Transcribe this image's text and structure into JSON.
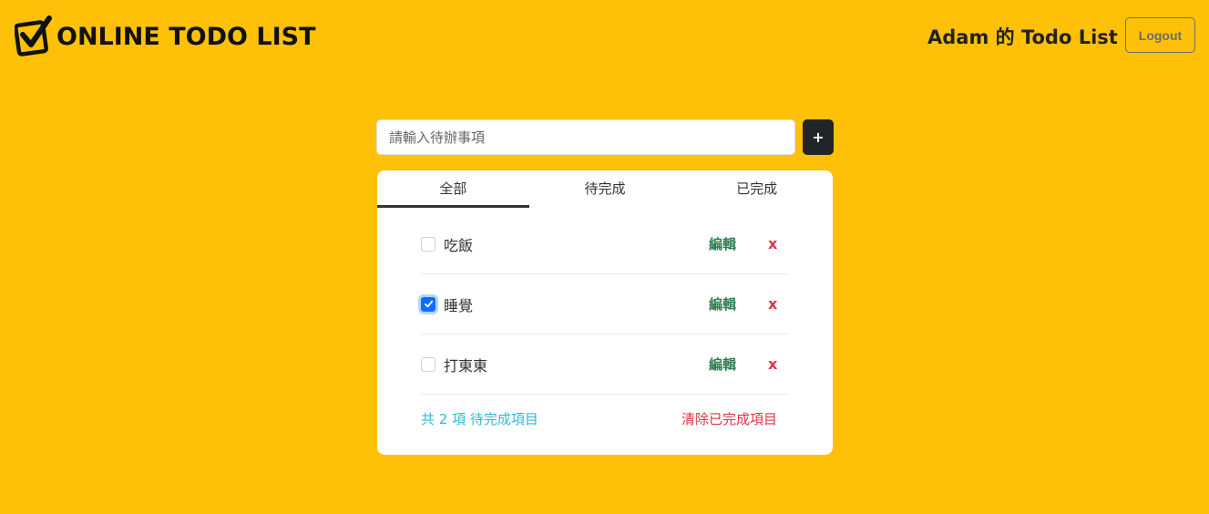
{
  "header": {
    "logo_text": "ONLINE TODO LIST",
    "user_title": "Adam 的 Todo List",
    "logout_label": "Logout"
  },
  "new_todo": {
    "placeholder": "請輸入待辦事項",
    "add_label": "+"
  },
  "tabs": [
    {
      "label": "全部",
      "active": true
    },
    {
      "label": "待完成",
      "active": false
    },
    {
      "label": "已完成",
      "active": false
    }
  ],
  "todos": [
    {
      "text": "吃飯",
      "done": false,
      "edit_label": "編輯",
      "delete_label": "x"
    },
    {
      "text": "睡覺",
      "done": true,
      "edit_label": "編輯",
      "delete_label": "x"
    },
    {
      "text": "打東東",
      "done": false,
      "edit_label": "編輯",
      "delete_label": "x"
    }
  ],
  "footer": {
    "pending_text": "共 2 項 待完成項目",
    "clear_label": "清除已完成項目"
  },
  "colors": {
    "background": "#FFC107",
    "edit": "#2e7d4f",
    "delete": "#dc3545",
    "pending": "#30b9d9",
    "checkbox_checked": "#0d6efd"
  }
}
